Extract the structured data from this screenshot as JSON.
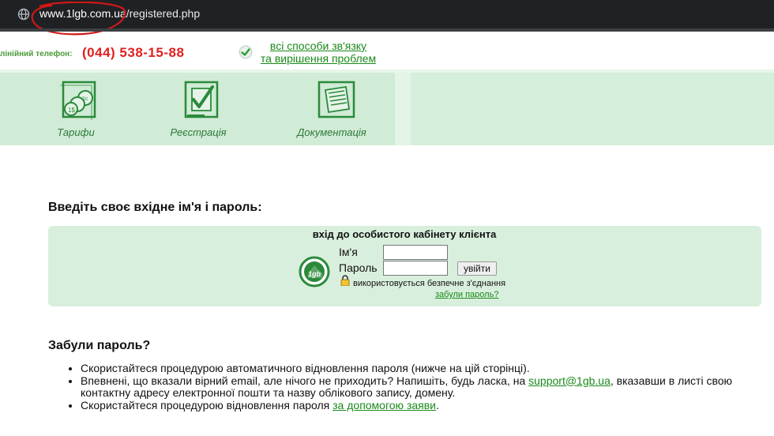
{
  "browser": {
    "url_host": "www.1lgb.com.ua",
    "url_path": "/registered.php"
  },
  "header": {
    "hotline_label": "лінійний телефон:",
    "phone": "(044) 538-15-88",
    "contact_link_line1": "всі способи зв'язку",
    "contact_link_line2": "та вирішення проблем"
  },
  "nav": {
    "items": [
      {
        "label": "Тарифи",
        "icon": "coins-icon"
      },
      {
        "label": "Реєстрація",
        "icon": "registration-checkmark-icon"
      },
      {
        "label": "Документація",
        "icon": "documentation-icon"
      }
    ]
  },
  "login": {
    "heading": "Введіть своє вхідне ім'я і пароль:",
    "box_title": "вхід до особистого кабінету клієнта",
    "name_label": "Ім'я",
    "password_label": "Пароль",
    "name_value": "",
    "password_value": "",
    "submit_label": "увійти",
    "secure_text": "використовується безпечне з'єднання",
    "forgot_link": "забули пароль?",
    "logo_text": "1gb"
  },
  "forgot": {
    "heading": "Забули пароль?",
    "item1": "Скористайтеся процедурою автоматичного відновлення пароля (нижче на цій сторінці).",
    "item2_before": "Впевнені, що вказали вірний email, але нічого не приходить? Напишіть, будь ласка, на ",
    "item2_link": "support@1gb.ua",
    "item2_after": ", вказавши в листі свою контактну адресу електронної пошти та назву облікового запису, домену.",
    "item3_before": "Скористайтеся процедурою відновлення пароля ",
    "item3_link": "за допомогою заяви",
    "item3_after": "."
  },
  "colors": {
    "brand_green": "#1a8a1a",
    "phone_red": "#e02020",
    "nav_band": "#d6eedc",
    "annotation_red": "#d01818"
  }
}
